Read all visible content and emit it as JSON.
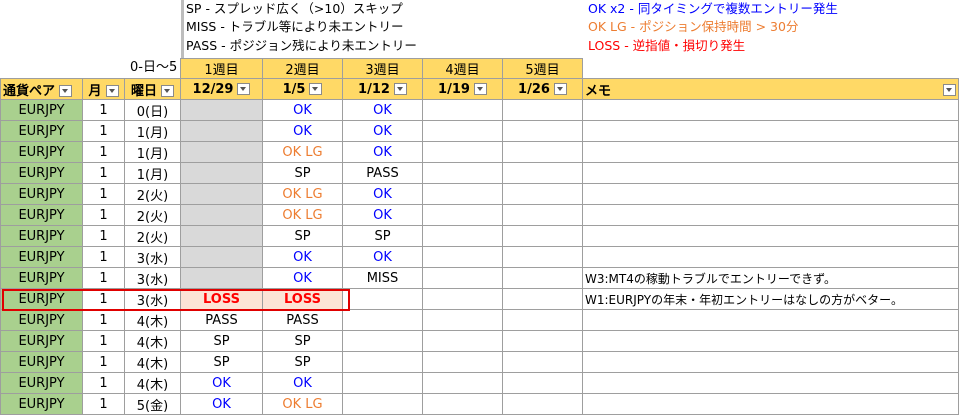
{
  "legend": {
    "left": [
      "SP - スプレッド広く（>10）スキップ",
      "MISS - トラブル等により未エントリー",
      "PASS - ポジジョン残により未エントリー"
    ],
    "right": [
      {
        "text": "OK x2 - 同タイミングで複数エントリー発生",
        "color": "#0000ff"
      },
      {
        "text": "OK LG - ポジション保持時間 > 30分",
        "color": "#ed7d31"
      },
      {
        "text": "LOSS - 逆指値・損切り発生",
        "color": "#ff0000"
      }
    ]
  },
  "corner_label": "0-日～5",
  "weeks": [
    "1週目",
    "2週目",
    "3週目",
    "4週目",
    "5週目"
  ],
  "headers": {
    "pair": "通貨ペア",
    "month": "月",
    "day": "曜日",
    "dates": [
      "12/29",
      "1/5",
      "1/12",
      "1/19",
      "1/26"
    ],
    "memo": "メモ"
  },
  "colors": {
    "header_bg": "#ffd966",
    "pair_bg": "#a9d08e",
    "gray": "#d9d9d9",
    "ok": "#0000ff",
    "oklg": "#ed7d31",
    "loss": "#ff0000"
  },
  "rows": [
    {
      "pair": "EURJPY",
      "month": "1",
      "day": "0(日)",
      "w": [
        "",
        "OK",
        "OK",
        "",
        ""
      ],
      "memo": ""
    },
    {
      "pair": "EURJPY",
      "month": "1",
      "day": "1(月)",
      "w": [
        "",
        "OK",
        "OK",
        "",
        ""
      ],
      "memo": ""
    },
    {
      "pair": "EURJPY",
      "month": "1",
      "day": "1(月)",
      "w": [
        "",
        "OK LG",
        "OK",
        "",
        ""
      ],
      "memo": ""
    },
    {
      "pair": "EURJPY",
      "month": "1",
      "day": "1(月)",
      "w": [
        "",
        "SP",
        "PASS",
        "",
        ""
      ],
      "memo": ""
    },
    {
      "pair": "EURJPY",
      "month": "1",
      "day": "2(火)",
      "w": [
        "",
        "OK LG",
        "OK",
        "",
        ""
      ],
      "memo": ""
    },
    {
      "pair": "EURJPY",
      "month": "1",
      "day": "2(火)",
      "w": [
        "",
        "OK LG",
        "OK",
        "",
        ""
      ],
      "memo": ""
    },
    {
      "pair": "EURJPY",
      "month": "1",
      "day": "2(火)",
      "w": [
        "",
        "SP",
        "SP",
        "",
        ""
      ],
      "memo": ""
    },
    {
      "pair": "EURJPY",
      "month": "1",
      "day": "3(水)",
      "w": [
        "",
        "OK",
        "OK",
        "",
        ""
      ],
      "memo": ""
    },
    {
      "pair": "EURJPY",
      "month": "1",
      "day": "3(水)",
      "w": [
        "",
        "OK",
        "MISS",
        "",
        ""
      ],
      "memo": "W3:MT4の稼動トラブルでエントリーできず。"
    },
    {
      "pair": "EURJPY",
      "month": "1",
      "day": "3(水)",
      "w": [
        "LOSS",
        "LOSS",
        "",
        "",
        ""
      ],
      "memo": "W1:EURJPYの年末・年初エントリーはなしの方がベター。"
    },
    {
      "pair": "EURJPY",
      "month": "1",
      "day": "4(木)",
      "w": [
        "PASS",
        "PASS",
        "",
        "",
        ""
      ],
      "memo": ""
    },
    {
      "pair": "EURJPY",
      "month": "1",
      "day": "4(木)",
      "w": [
        "SP",
        "SP",
        "",
        "",
        ""
      ],
      "memo": ""
    },
    {
      "pair": "EURJPY",
      "month": "1",
      "day": "4(木)",
      "w": [
        "SP",
        "SP",
        "",
        "",
        ""
      ],
      "memo": ""
    },
    {
      "pair": "EURJPY",
      "month": "1",
      "day": "4(木)",
      "w": [
        "OK",
        "OK",
        "",
        "",
        ""
      ],
      "memo": ""
    },
    {
      "pair": "EURJPY",
      "month": "1",
      "day": "5(金)",
      "w": [
        "OK",
        "OK LG",
        "",
        "",
        ""
      ],
      "memo": ""
    }
  ]
}
